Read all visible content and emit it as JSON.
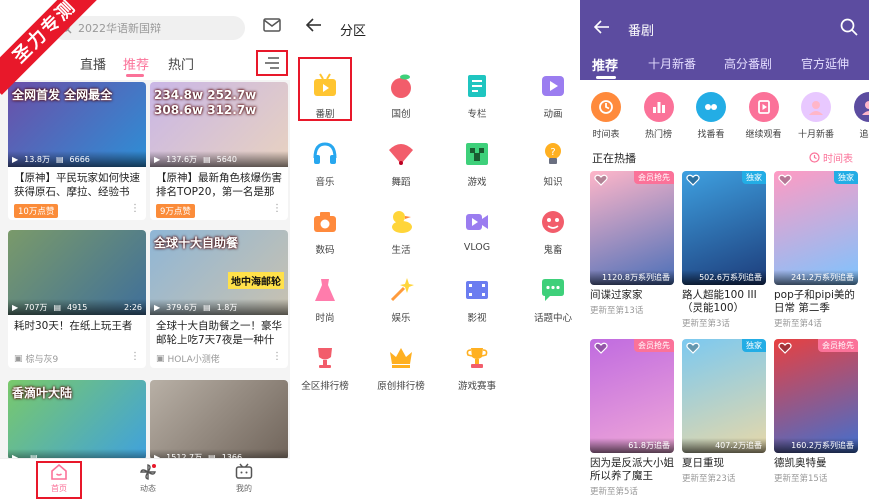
{
  "watermark": "圣力专测",
  "panel1": {
    "search_placeholder": "2022华语新国辩",
    "tabs": [
      "直播",
      "推荐",
      "热门"
    ],
    "cards": [
      {
        "title": "【原神】平民玩家如何快速获得原石、摩拉、经验书",
        "badge": "10万点赞",
        "stats": [
          "13.8万",
          "6666"
        ],
        "duration": "",
        "thumb_text": "全网首发 全网最全",
        "thumb_colors": [
          "#6b4fa8",
          "#2d8fd6"
        ]
      },
      {
        "title": "【原神】最新角色核爆伤害排名TOP20，第一名是那",
        "badge": "9万点赞",
        "stats": [
          "137.6万",
          "5640"
        ],
        "duration": "",
        "thumb_text": "234.8w 252.7w 308.6w 312.7w",
        "thumb_colors": [
          "#c9b6e6",
          "#e8d2c0"
        ]
      },
      {
        "title": "耗时30天！在纸上玩王者",
        "badge": "",
        "up": "棕与灰9",
        "stats": [
          "707万",
          "4915"
        ],
        "duration": "2:26",
        "thumb_text": "",
        "thumb_colors": [
          "#7a9a6a",
          "#3f6f9a"
        ]
      },
      {
        "title": "全球十大自助餐之一！豪华邮轮上吃7天7夜是一种什",
        "badge": "",
        "up": "HOLA小测佬",
        "stats": [
          "379.6万",
          "1.8万"
        ],
        "duration": "",
        "thumb_text": "全球十大自助餐",
        "thumb_sub": "地中海邮轮",
        "thumb_colors": [
          "#8fb6d6",
          "#c9c2b0"
        ]
      },
      {
        "title": "",
        "badge": "",
        "stats": [
          "",
          ""
        ],
        "duration": "",
        "thumb_text": "香滴叶大陆",
        "thumb_colors": [
          "#7ac96a",
          "#3ea0e0"
        ]
      },
      {
        "title": "",
        "badge": "",
        "stats": [
          "1512.7万",
          "1366"
        ],
        "duration": "",
        "thumb_text": "",
        "thumb_colors": [
          "#b8b0a6",
          "#6e6258"
        ]
      }
    ],
    "bottom_nav": [
      {
        "label": "首页",
        "icon": "home-icon"
      },
      {
        "label": "动态",
        "icon": "pinwheel-icon"
      },
      {
        "label": "我的",
        "icon": "tv-icon"
      }
    ],
    "accent": "#fb7299"
  },
  "panel2": {
    "title": "分区",
    "categories": [
      {
        "label": "番剧",
        "icon": "anime-tv-icon",
        "color": "#ffc531"
      },
      {
        "label": "国创",
        "icon": "peach-icon",
        "color": "#f25d6b"
      },
      {
        "label": "专栏",
        "icon": "column-icon",
        "color": "#1fc5c0"
      },
      {
        "label": "动画",
        "icon": "play-icon",
        "color": "#9b7df0"
      },
      {
        "label": "音乐",
        "icon": "headphone-icon",
        "color": "#27a7ef"
      },
      {
        "label": "舞蹈",
        "icon": "fan-icon",
        "color": "#f25d6b"
      },
      {
        "label": "游戏",
        "icon": "creeper-icon",
        "color": "#3ed07a"
      },
      {
        "label": "知识",
        "icon": "lightbulb-icon",
        "color": "#ffb021"
      },
      {
        "label": "数码",
        "icon": "camera-icon",
        "color": "#ff8a3c"
      },
      {
        "label": "生活",
        "icon": "duck-icon",
        "color": "#ffd53a"
      },
      {
        "label": "VLOG",
        "icon": "vlog-icon",
        "color": "#9b7df0"
      },
      {
        "label": "鬼畜",
        "icon": "ghost-icon",
        "color": "#f25d6b"
      },
      {
        "label": "时尚",
        "icon": "dress-icon",
        "color": "#ff7cac"
      },
      {
        "label": "娱乐",
        "icon": "magic-wand-icon",
        "color": "#ff9b3c"
      },
      {
        "label": "影视",
        "icon": "film-icon",
        "color": "#6b7df0"
      },
      {
        "label": "话题中心",
        "icon": "chat-icon",
        "color": "#3ed07a"
      },
      {
        "label": "全区排行榜",
        "icon": "trophy-icon",
        "color": "#f25d6b"
      },
      {
        "label": "原创排行榜",
        "icon": "crown-icon",
        "color": "#ffb021"
      },
      {
        "label": "游戏赛事",
        "icon": "cup-icon",
        "color": "#ffb021"
      }
    ]
  },
  "panel3": {
    "title": "番剧",
    "tabs": [
      "推荐",
      "十月新番",
      "高分番剧",
      "官方延伸"
    ],
    "quick": [
      {
        "label": "时间表",
        "color": "#ff8a3c",
        "icon": "clock-icon"
      },
      {
        "label": "热门榜",
        "color": "#fb7299",
        "icon": "chart-icon"
      },
      {
        "label": "找番看",
        "color": "#23ade5",
        "icon": "find-icon"
      },
      {
        "label": "继续观看",
        "color": "#fb7299",
        "icon": "continue-icon"
      },
      {
        "label": "十月新番",
        "color": "#e8c8ff",
        "icon": "avatar-icon"
      },
      {
        "label": "追番",
        "color": "#5c4ca0",
        "icon": "avatar-icon"
      }
    ],
    "section_title": "正在热播",
    "timetable_link": "时间表",
    "anime": [
      {
        "name": "间谍过家家",
        "update": "更新至第13话",
        "follow": "1120.8万系列追番",
        "tag": "会员抢先",
        "tag_type": "vip",
        "colors": [
          "#ffb6c9",
          "#4a6fb8"
        ]
      },
      {
        "name": "路人超能100 III（灵能100）",
        "update": "更新至第3话",
        "follow": "502.6万系列追番",
        "tag": "独家",
        "tag_type": "only",
        "colors": [
          "#3ea0e0",
          "#1d3c7a"
        ]
      },
      {
        "name": "pop子和pipi美的日常 第二季",
        "update": "更新至第4话",
        "follow": "241.2万系列追番",
        "tag": "独家",
        "tag_type": "only",
        "colors": [
          "#ff9bc3",
          "#7cc4ff"
        ]
      },
      {
        "name": "因为是反派大小姐所以养了魔王",
        "update": "更新至第5话",
        "follow": "61.8万追番",
        "tag": "会员抢先",
        "tag_type": "vip",
        "colors": [
          "#c06be0",
          "#f0a8d8"
        ]
      },
      {
        "name": "夏日重现",
        "update": "更新至第23话",
        "follow": "407.2万追番",
        "tag": "独家",
        "tag_type": "only",
        "colors": [
          "#7cc9f0",
          "#e8d8a8"
        ]
      },
      {
        "name": "德凯奥特曼",
        "update": "更新至第15话",
        "follow": "160.2万系列追番",
        "tag": "会员抢先",
        "tag_type": "vip",
        "colors": [
          "#e84040",
          "#4070d0"
        ]
      }
    ],
    "header_color": "#5c4ca0"
  }
}
